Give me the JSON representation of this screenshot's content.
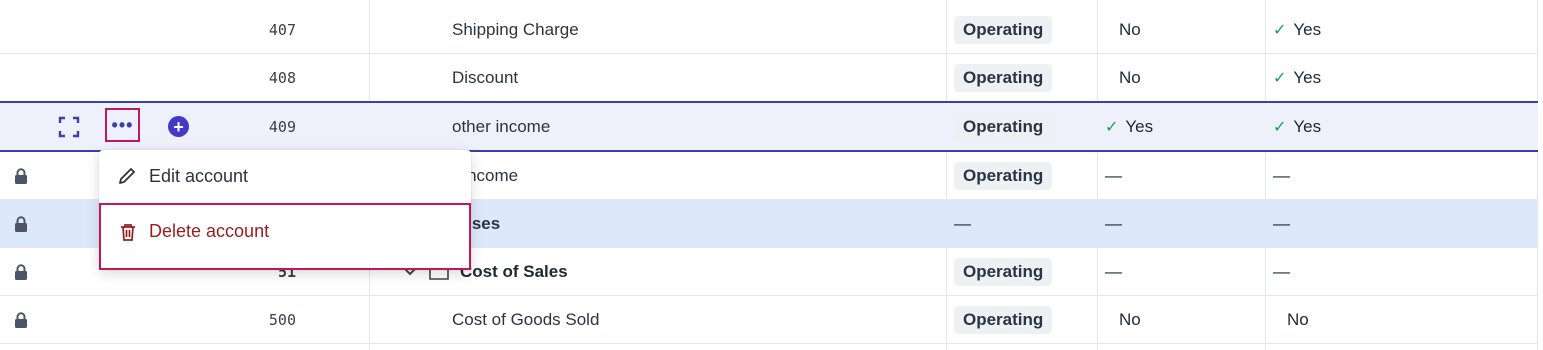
{
  "rows": [
    {
      "code": "407",
      "name": "Shipping Charge",
      "type": "Operating",
      "col_a": "No",
      "col_b": "Yes"
    },
    {
      "code": "408",
      "name": "Discount",
      "type": "Operating",
      "col_a": "No",
      "col_b": "Yes"
    },
    {
      "code": "409",
      "name": "other income",
      "type": "Operating",
      "col_a": "Yes",
      "col_b": "Yes"
    },
    {
      "code": "",
      "name": "r Income",
      "type": "Operating",
      "col_a": "—",
      "col_b": "—"
    },
    {
      "code": "",
      "name": "enses",
      "type": "—",
      "col_a": "—",
      "col_b": "—"
    },
    {
      "code": "51",
      "name": "Cost of Sales",
      "type": "Operating",
      "col_a": "—",
      "col_b": "—"
    },
    {
      "code": "500",
      "name": "Cost of Goods Sold",
      "type": "Operating",
      "col_a": "No",
      "col_b": "No"
    }
  ],
  "row_actions": {
    "more": "•••",
    "add": "+"
  },
  "context_menu": {
    "edit_label": "Edit account",
    "delete_label": "Delete account"
  },
  "colors": {
    "accent": "#3b3fa8",
    "selected_row": "#eef0fb",
    "highlight_row": "#dde9fb",
    "delete": "#9b1c1c",
    "check": "#1e9e5a",
    "annotation": "#c2185b"
  },
  "icons": [
    "lock-icon",
    "focus-icon",
    "more-icon",
    "add-icon",
    "pencil-icon",
    "trash-icon",
    "check-icon",
    "chevron-down-icon",
    "folder-icon"
  ]
}
